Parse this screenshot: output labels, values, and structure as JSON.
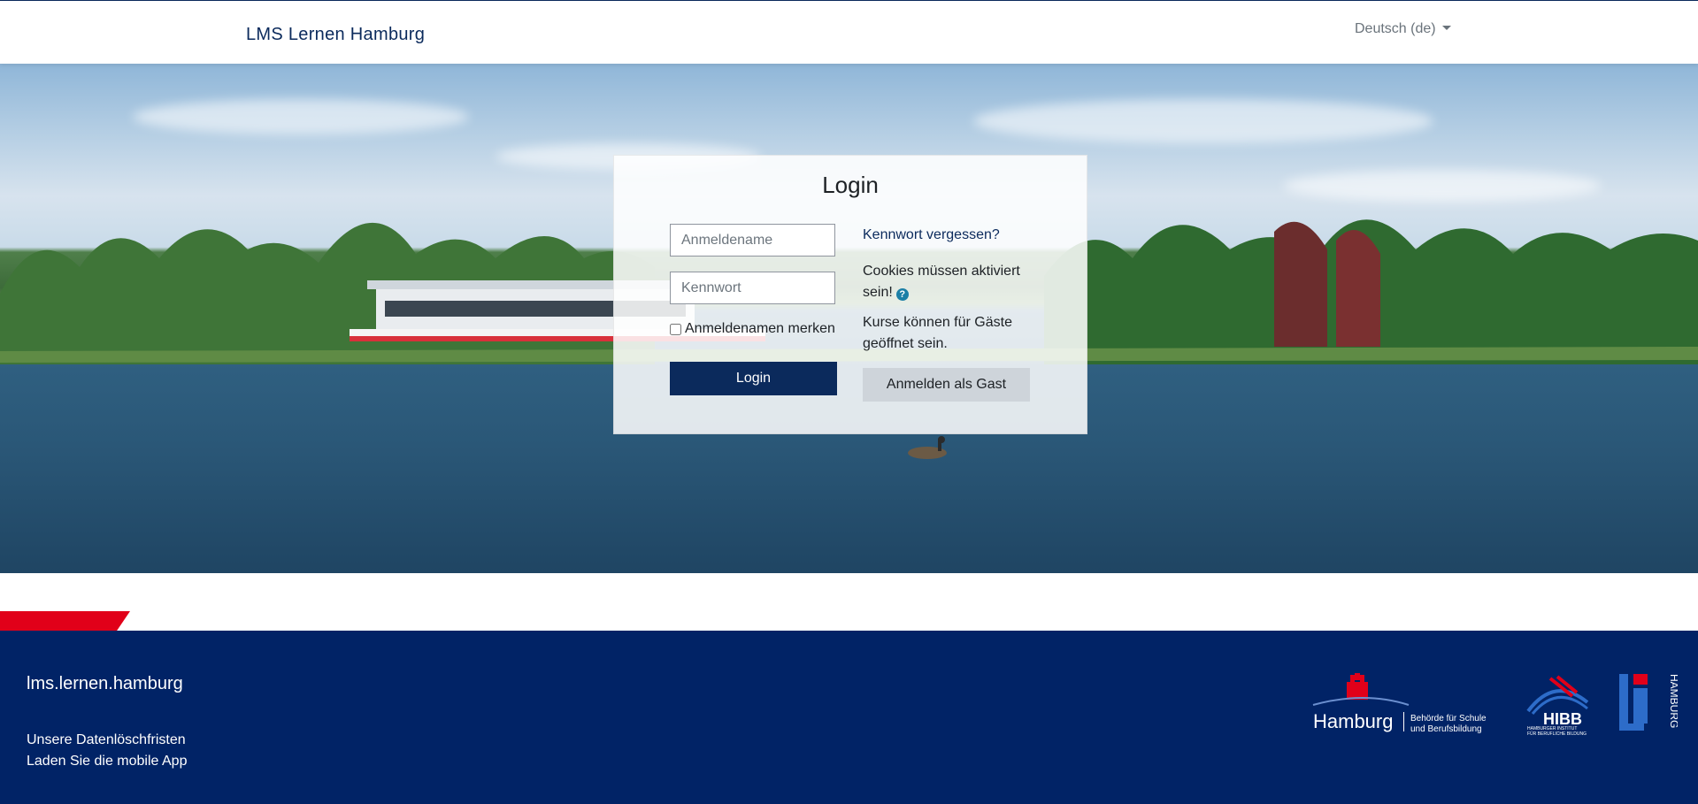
{
  "header": {
    "brand": "LMS Lernen Hamburg",
    "language": "Deutsch (de)"
  },
  "login": {
    "title": "Login",
    "username_placeholder": "Anmeldename",
    "password_placeholder": "Kennwort",
    "remember_label": "Anmeldenamen merken",
    "login_button": "Login",
    "forgot_link": "Kennwort vergessen?",
    "cookies_text": "Cookies müssen aktiviert sein!",
    "guests_text": "Kurse können für Gäste geöffnet sein.",
    "guest_button": "Anmelden als Gast"
  },
  "footer": {
    "site_name": "lms.lernen.hamburg",
    "links": [
      "Unsere Datenlöschfristen",
      "Laden Sie die mobile App"
    ],
    "logos": {
      "hamburg": {
        "name": "Hamburg",
        "line1": "Behörde für Schule",
        "line2": "und Berufsbildung"
      },
      "hibb": {
        "name": "HIBB",
        "sub1": "HAMBURGER INSTITUT",
        "sub2": "FÜR BERUFLICHE BILDUNG"
      },
      "li": {
        "name": "HAMBURG"
      }
    }
  },
  "colors": {
    "brand_navy": "#0b2a5c",
    "footer_bg": "#012366",
    "accent_red": "#e10019",
    "guest_button": "#ced4da"
  }
}
